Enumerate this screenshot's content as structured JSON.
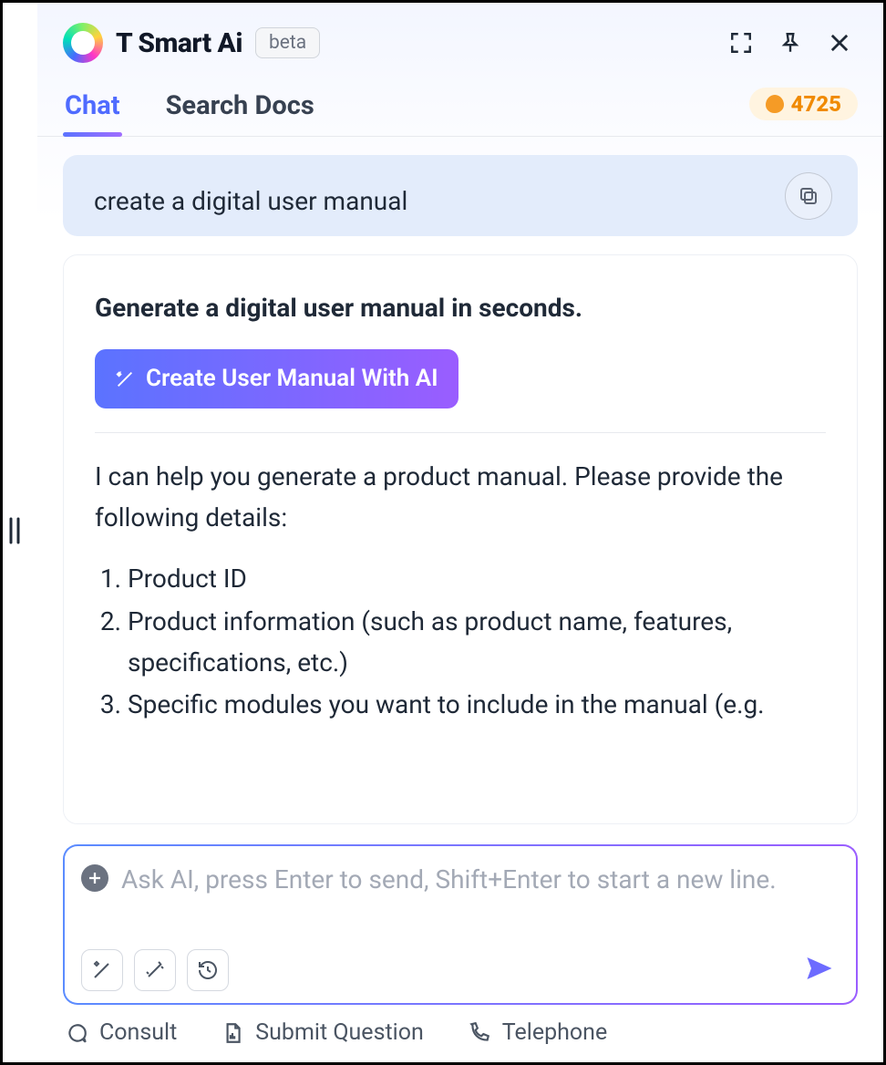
{
  "header": {
    "title": "T Smart Ai",
    "badge": "beta"
  },
  "tabs": {
    "chat": "Chat",
    "search_docs": "Search Docs"
  },
  "credits": "4725",
  "user_message": "create a digital user manual",
  "ai": {
    "heading": "Generate a digital user manual in seconds.",
    "cta": "Create User Manual With AI",
    "body": "I can help you generate a product manual. Please provide the following details:",
    "items": [
      "Product ID",
      "Product information (such as product name, features, specifications, etc.)",
      "Specific modules you want to include in the manual (e.g."
    ]
  },
  "input": {
    "placeholder": "Ask AI, press Enter to send, Shift+Enter to start a new line."
  },
  "footer": {
    "consult": "Consult",
    "submit": "Submit Question",
    "telephone": "Telephone"
  }
}
